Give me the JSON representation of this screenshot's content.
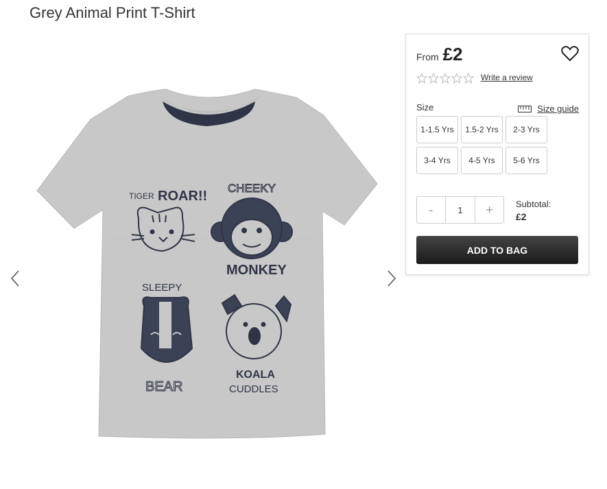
{
  "product": {
    "title": "Grey Animal Print T-Shirt",
    "image_alt": "grey t-shirt with animal prints",
    "print_texts": [
      "TIGER",
      "ROAR!!",
      "CHEEKY",
      "MONKEY",
      "SLEEPY",
      "BEAR",
      "KOALA",
      "CUDDLES"
    ]
  },
  "panel": {
    "from_label": "From",
    "price": "£2",
    "rating_stars": 0,
    "review_link": "Write a review",
    "size_label": "Size",
    "size_guide": "Size guide",
    "sizes": [
      "1-1.5 Yrs",
      "1.5-2 Yrs",
      "2-3 Yrs",
      "3-4 Yrs",
      "4-5 Yrs",
      "5-6 Yrs"
    ],
    "qty_minus": "-",
    "qty_value": "1",
    "qty_plus": "+",
    "subtotal_label": "Subtotal:",
    "subtotal_value": "£2",
    "add_button": "ADD TO BAG"
  },
  "colors": {
    "button_dark": "#2a2a2a",
    "shirt_grey": "#c9c9c9",
    "print_navy": "#2f3546"
  },
  "icons": [
    "chevron-left-icon",
    "chevron-right-icon",
    "heart-icon",
    "star-icon",
    "ruler-icon"
  ]
}
